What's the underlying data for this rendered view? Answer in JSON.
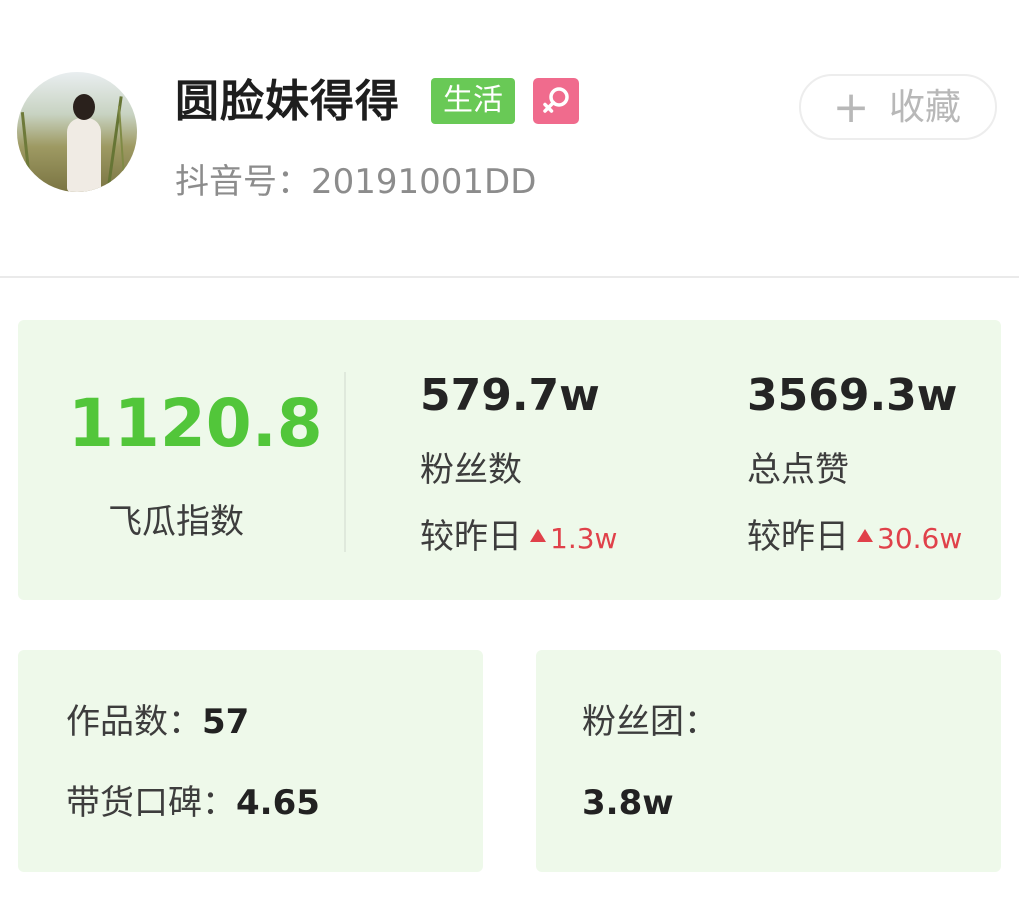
{
  "profile": {
    "name": "圆脸妹得得",
    "category_tag": "生活",
    "gender_icon": "female-icon",
    "douyin_id": "抖音号：20191001DD"
  },
  "favorite": {
    "plus_icon": "plus-icon",
    "label": "收藏"
  },
  "stats": {
    "index": {
      "value": "1120.8",
      "label": "飞瓜指数"
    },
    "fans": {
      "value": "579.7w",
      "label": "粉丝数",
      "compare_label": "较昨日",
      "delta": "1.3w"
    },
    "likes": {
      "value": "3569.3w",
      "label": "总点赞",
      "compare_label": "较昨日",
      "delta": "30.6w"
    }
  },
  "details": {
    "works_label": "作品数：",
    "works_value": "57",
    "reputation_label": "带货口碑：",
    "reputation_value": "4.65",
    "fan_group_label": "粉丝团：",
    "fan_group_value": "3.8w"
  },
  "colors": {
    "accent_green": "#52c63a",
    "tag_green": "#69c956",
    "badge_pink": "#f06b8d",
    "delta_red": "#e0414a",
    "card_bg": "#eef9ea"
  }
}
